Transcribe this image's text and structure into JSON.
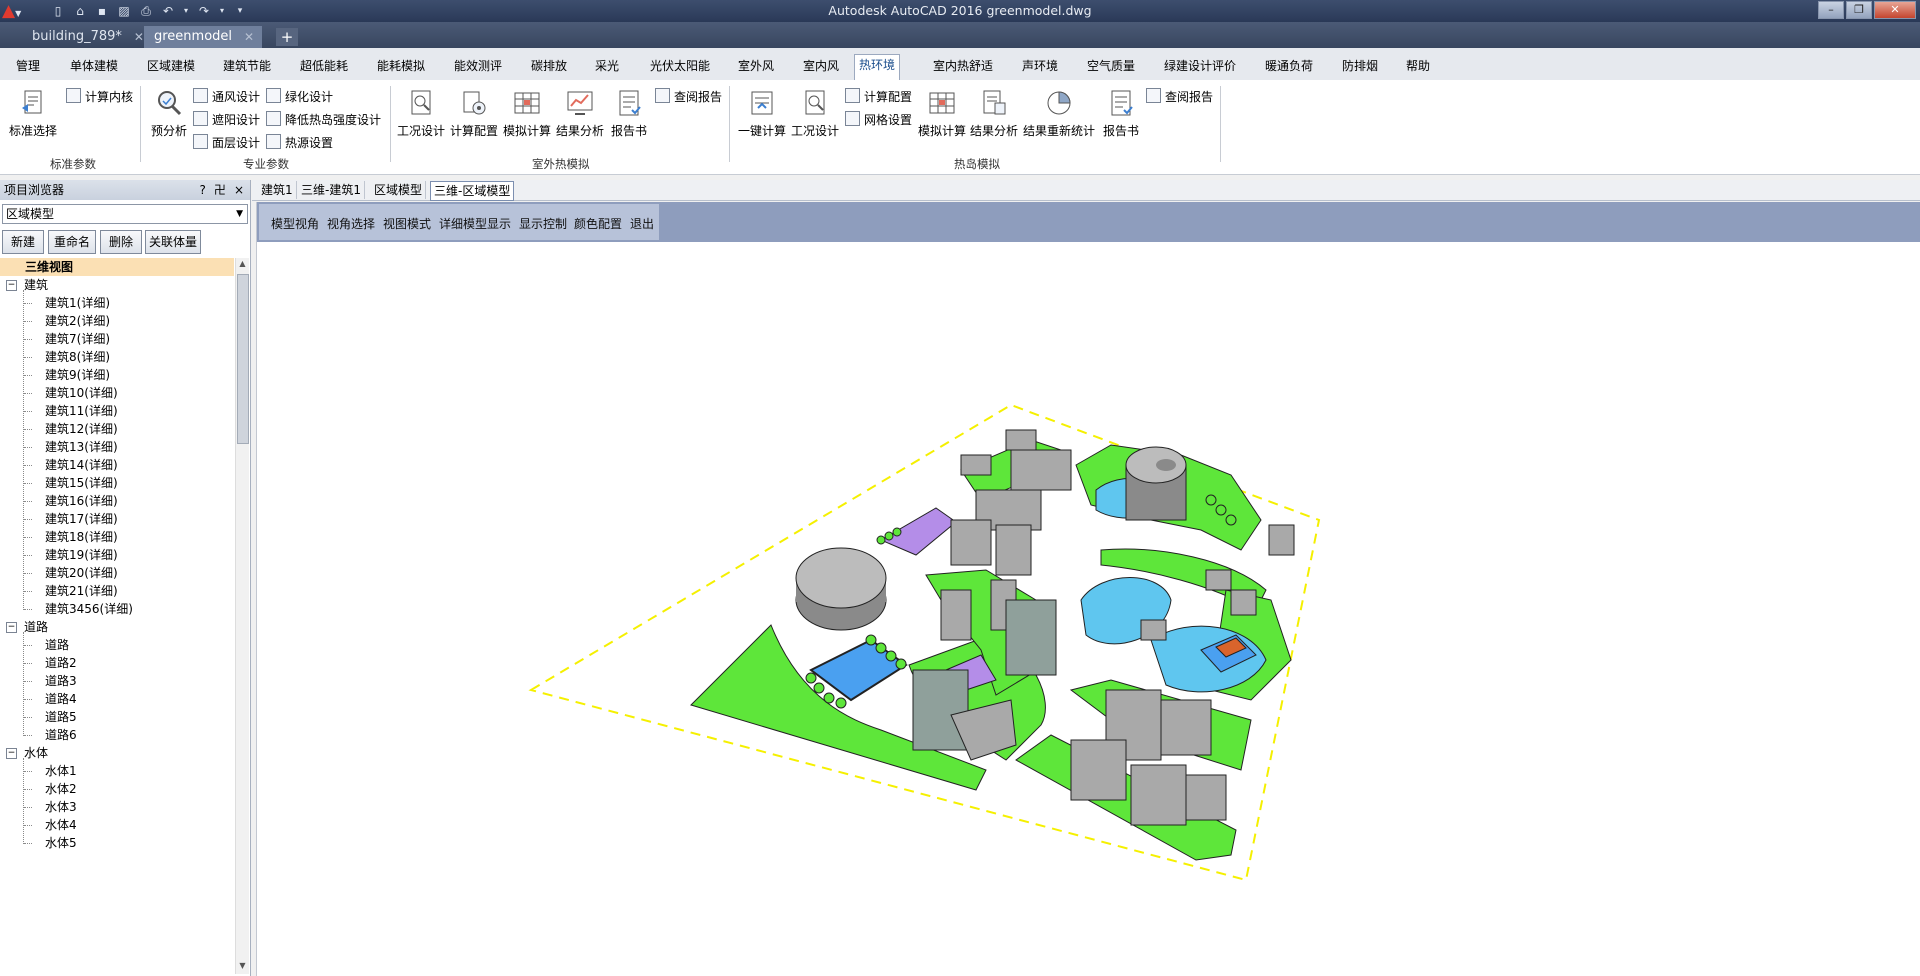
{
  "titlebar": {
    "app": "Autodesk AutoCAD 2016",
    "file": "greenmodel.dwg",
    "title": "Autodesk AutoCAD 2016    greenmodel.dwg"
  },
  "file_tabs": [
    {
      "label": "building_789*"
    },
    {
      "label": "greenmodel"
    }
  ],
  "ribbon_tabs": [
    "管理",
    "单体建模",
    "区域建模",
    "建筑节能",
    "超低能耗",
    "能耗模拟",
    "能效测评",
    "碳排放",
    "采光",
    "光伏太阳能",
    "室外风",
    "室内风",
    "热环境",
    "室内热舒适",
    "声环境",
    "空气质量",
    "绿建设计评价",
    "暖通负荷",
    "防排烟",
    "帮助"
  ],
  "ribbon_active": "热环境",
  "ribbon": {
    "std": {
      "big": "标准选择",
      "small": "计算内核",
      "group": "标准参数"
    },
    "pro": {
      "big": "预分析",
      "s1": "通风设计",
      "s2": "遮阳设计",
      "s3": "面层设计",
      "s4": "绿化设计",
      "s5": "降低热岛强度设计",
      "s6": "热源设置",
      "group": "专业参数"
    },
    "outdoor": {
      "b1": "工况设计",
      "b2": "计算配置",
      "b3": "模拟计算",
      "b4": "结果分析",
      "b5": "报告书",
      "s1": "查阅报告",
      "group": "室外热模拟"
    },
    "island": {
      "b1": "一键计算",
      "b2": "工况设计",
      "s1": "计算配置",
      "s2": "网格设置",
      "b3": "模拟计算",
      "b4": "结果分析",
      "b5": "结果重新统计",
      "b6": "报告书",
      "s3": "查阅报告",
      "group": "热岛模拟"
    }
  },
  "browser": {
    "title": "项目浏览器",
    "hdr_btns": [
      "?",
      "卍",
      "×"
    ],
    "combo_value": "区域模型",
    "buttons": [
      "新建",
      "重命名",
      "删除",
      "关联体量"
    ],
    "tree": {
      "root": "三维视图",
      "building_group": "建筑",
      "buildings": [
        "建筑1(详细)",
        "建筑2(详细)",
        "建筑7(详细)",
        "建筑8(详细)",
        "建筑9(详细)",
        "建筑10(详细)",
        "建筑11(详细)",
        "建筑12(详细)",
        "建筑13(详细)",
        "建筑14(详细)",
        "建筑15(详细)",
        "建筑16(详细)",
        "建筑17(详细)",
        "建筑18(详细)",
        "建筑19(详细)",
        "建筑20(详细)",
        "建筑21(详细)",
        "建筑3456(详细)"
      ],
      "road_group": "道路",
      "roads": [
        "道路",
        "道路2",
        "道路3",
        "道路4",
        "道路5",
        "道路6"
      ],
      "water_group": "水体",
      "waters": [
        "水体1",
        "水体2",
        "水体3",
        "水体4",
        "水体5"
      ]
    }
  },
  "doc_tabs": [
    "建筑1",
    "三维-建筑1",
    "区域模型",
    "三维-区域模型"
  ],
  "doc_tab_active": "三维-区域模型",
  "view_toolbar": [
    "模型视角",
    "视角选择",
    "视图模式",
    "详细模型显示",
    "显示控制",
    "颜色配置",
    "退出"
  ],
  "colors": {
    "green": "#5ee63a",
    "water": "#5fc6ef",
    "plaza": "#b48de8",
    "building": "#a9a9a9",
    "boundary": "#f5f000",
    "accent": "#1a4d8c"
  }
}
